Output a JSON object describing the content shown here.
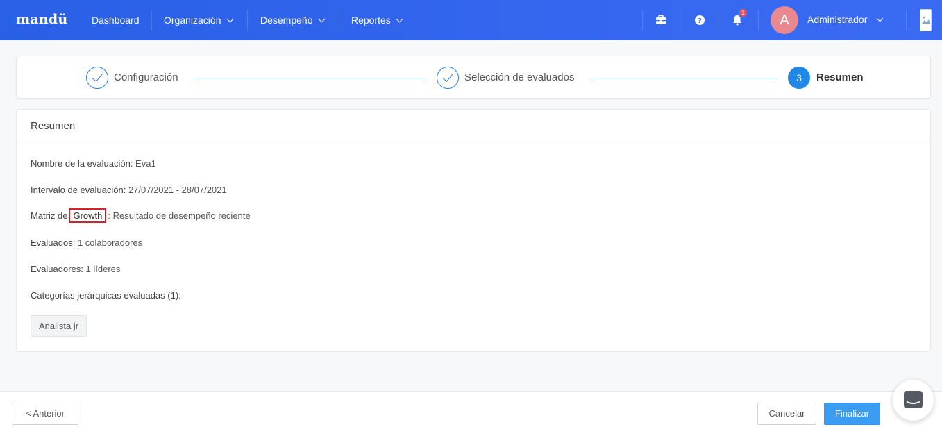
{
  "nav": {
    "logo": "mandü",
    "items": [
      {
        "label": "Dashboard"
      },
      {
        "label": "Organización"
      },
      {
        "label": "Desempeño"
      },
      {
        "label": "Reportes"
      }
    ],
    "notification_count": "1",
    "avatar_initial": "A",
    "user_name": "Administrador",
    "accent_color": "#3566ef"
  },
  "stepper": {
    "steps": [
      {
        "label": "Configuración",
        "state": "done"
      },
      {
        "label": "Selección de evaluados",
        "state": "done"
      },
      {
        "number": "3",
        "label": "Resumen",
        "state": "active"
      }
    ]
  },
  "summary": {
    "title": "Resumen",
    "name_label": "Nombre de la evaluación:",
    "name_value": "Eva1",
    "interval_label": "Intervalo de evaluación:",
    "interval_value": "27/07/2021 - 28/07/2021",
    "matrix_label": "Matriz de",
    "matrix_highlight": "Growth",
    "matrix_value": ": Resultado de desempeño reciente",
    "evaluated_label": "Evaluados:",
    "evaluated_value": "1 colaboradores",
    "evaluators_label": "Evaluadores:",
    "evaluators_value": "1 líderes",
    "categories_label": "Categorías jerárquicas evaluadas (1):",
    "categories": [
      "Analista jr"
    ]
  },
  "footer": {
    "prev_label": "< Anterior",
    "cancel_label": "Cancelar",
    "finish_label": "Finalizar"
  }
}
